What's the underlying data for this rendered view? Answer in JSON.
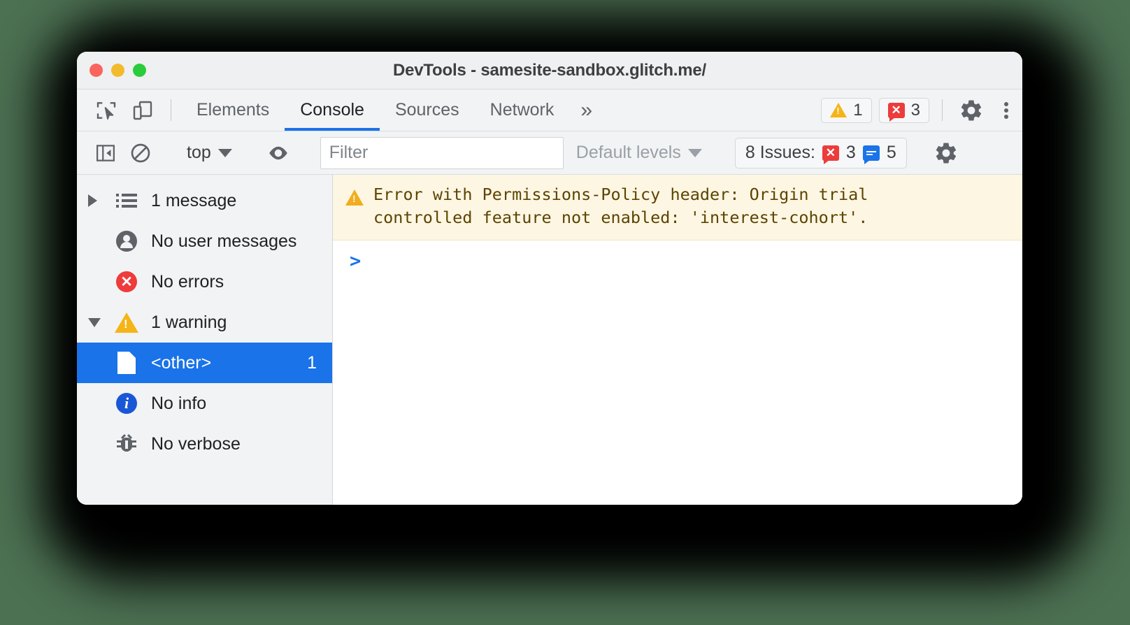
{
  "window": {
    "title": "DevTools - samesite-sandbox.glitch.me/",
    "traffic_lights": [
      "close-red",
      "minimize-yellow",
      "maximize-green"
    ]
  },
  "tabbar": {
    "inspect_icon": "inspect-element-icon",
    "device_icon": "device-toolbar-icon",
    "tabs": [
      {
        "label": "Elements",
        "active": false
      },
      {
        "label": "Console",
        "active": true
      },
      {
        "label": "Sources",
        "active": false
      },
      {
        "label": "Network",
        "active": false
      }
    ],
    "more_tabs_label": "»",
    "warning_badge": {
      "icon": "warning-triangle-icon",
      "count": "1"
    },
    "error_badge": {
      "icon": "error-bubble-icon",
      "count": "3"
    },
    "settings_icon": "gear-icon",
    "menu_icon": "kebab-menu-icon"
  },
  "consolebar": {
    "sidebar_toggle_icon": "console-sidebar-toggle-icon",
    "clear_icon": "clear-console-icon",
    "context": "top",
    "eye_icon": "live-expression-eye-icon",
    "filter_placeholder": "Filter",
    "filter_value": "",
    "levels_label": "Default levels",
    "issues_label": "8 Issues:",
    "issues_error_count": "3",
    "issues_info_count": "5",
    "settings_icon": "gear-icon"
  },
  "sidebar": {
    "items": [
      {
        "label": "1 message",
        "icon": "list-icon",
        "twisty": "right",
        "count": ""
      },
      {
        "label": "No user messages",
        "icon": "user-icon",
        "twisty": "",
        "count": ""
      },
      {
        "label": "No errors",
        "icon": "error-icon",
        "twisty": "",
        "count": ""
      },
      {
        "label": "1 warning",
        "icon": "warning-icon",
        "twisty": "down",
        "count": ""
      },
      {
        "label": "<other>",
        "icon": "document-icon",
        "twisty": "",
        "count": "1",
        "selected": true
      },
      {
        "label": "No info",
        "icon": "info-icon",
        "twisty": "",
        "count": ""
      },
      {
        "label": "No verbose",
        "icon": "bug-icon",
        "twisty": "",
        "count": ""
      }
    ]
  },
  "console": {
    "messages": [
      {
        "level": "warning",
        "icon": "warning-triangle-icon",
        "text": "Error with Permissions-Policy header: Origin trial\ncontrolled feature not enabled: 'interest-cohort'."
      }
    ],
    "prompt": ">"
  },
  "colors": {
    "accent_blue": "#1a73e8",
    "warning_yellow": "#f5b417",
    "error_red": "#ee3b3b",
    "toolbar_bg": "#f1f3f4",
    "warning_banner_bg": "#fdf6e3",
    "page_bg": "#4c7052"
  }
}
